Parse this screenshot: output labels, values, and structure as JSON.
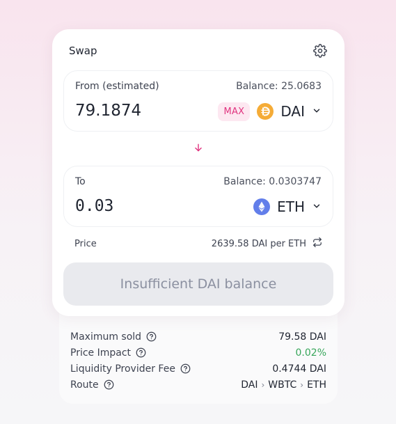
{
  "swap": {
    "title": "Swap",
    "from": {
      "label": "From (estimated)",
      "balance": "Balance: 25.0683",
      "amount": "79.1874",
      "max_label": "MAX",
      "token": "DAI"
    },
    "to": {
      "label": "To",
      "balance": "Balance: 0.0303747",
      "amount": "0.03",
      "token": "ETH"
    },
    "price": {
      "label": "Price",
      "value": "2639.58 DAI per ETH"
    },
    "action_label": "Insufficient DAI balance"
  },
  "details": {
    "maximum_sold": {
      "label": "Maximum sold",
      "value": "79.58 DAI"
    },
    "price_impact": {
      "label": "Price Impact",
      "value": "0.02%"
    },
    "lp_fee": {
      "label": "Liquidity Provider Fee",
      "value": "0.4744 DAI"
    },
    "route": {
      "label": "Route",
      "hops": [
        "DAI",
        "WBTC",
        "ETH"
      ]
    }
  },
  "colors": {
    "accent_pink": "#e0347f",
    "positive_green": "#37a65a",
    "dai_yellow": "#f5ac37",
    "eth_blue": "#627eea"
  },
  "icons": [
    "gear-icon",
    "arrow-down-icon",
    "chevron-down-icon",
    "swap-horizontal-icon",
    "help-circle-icon",
    "dai-token-icon",
    "eth-token-icon"
  ]
}
